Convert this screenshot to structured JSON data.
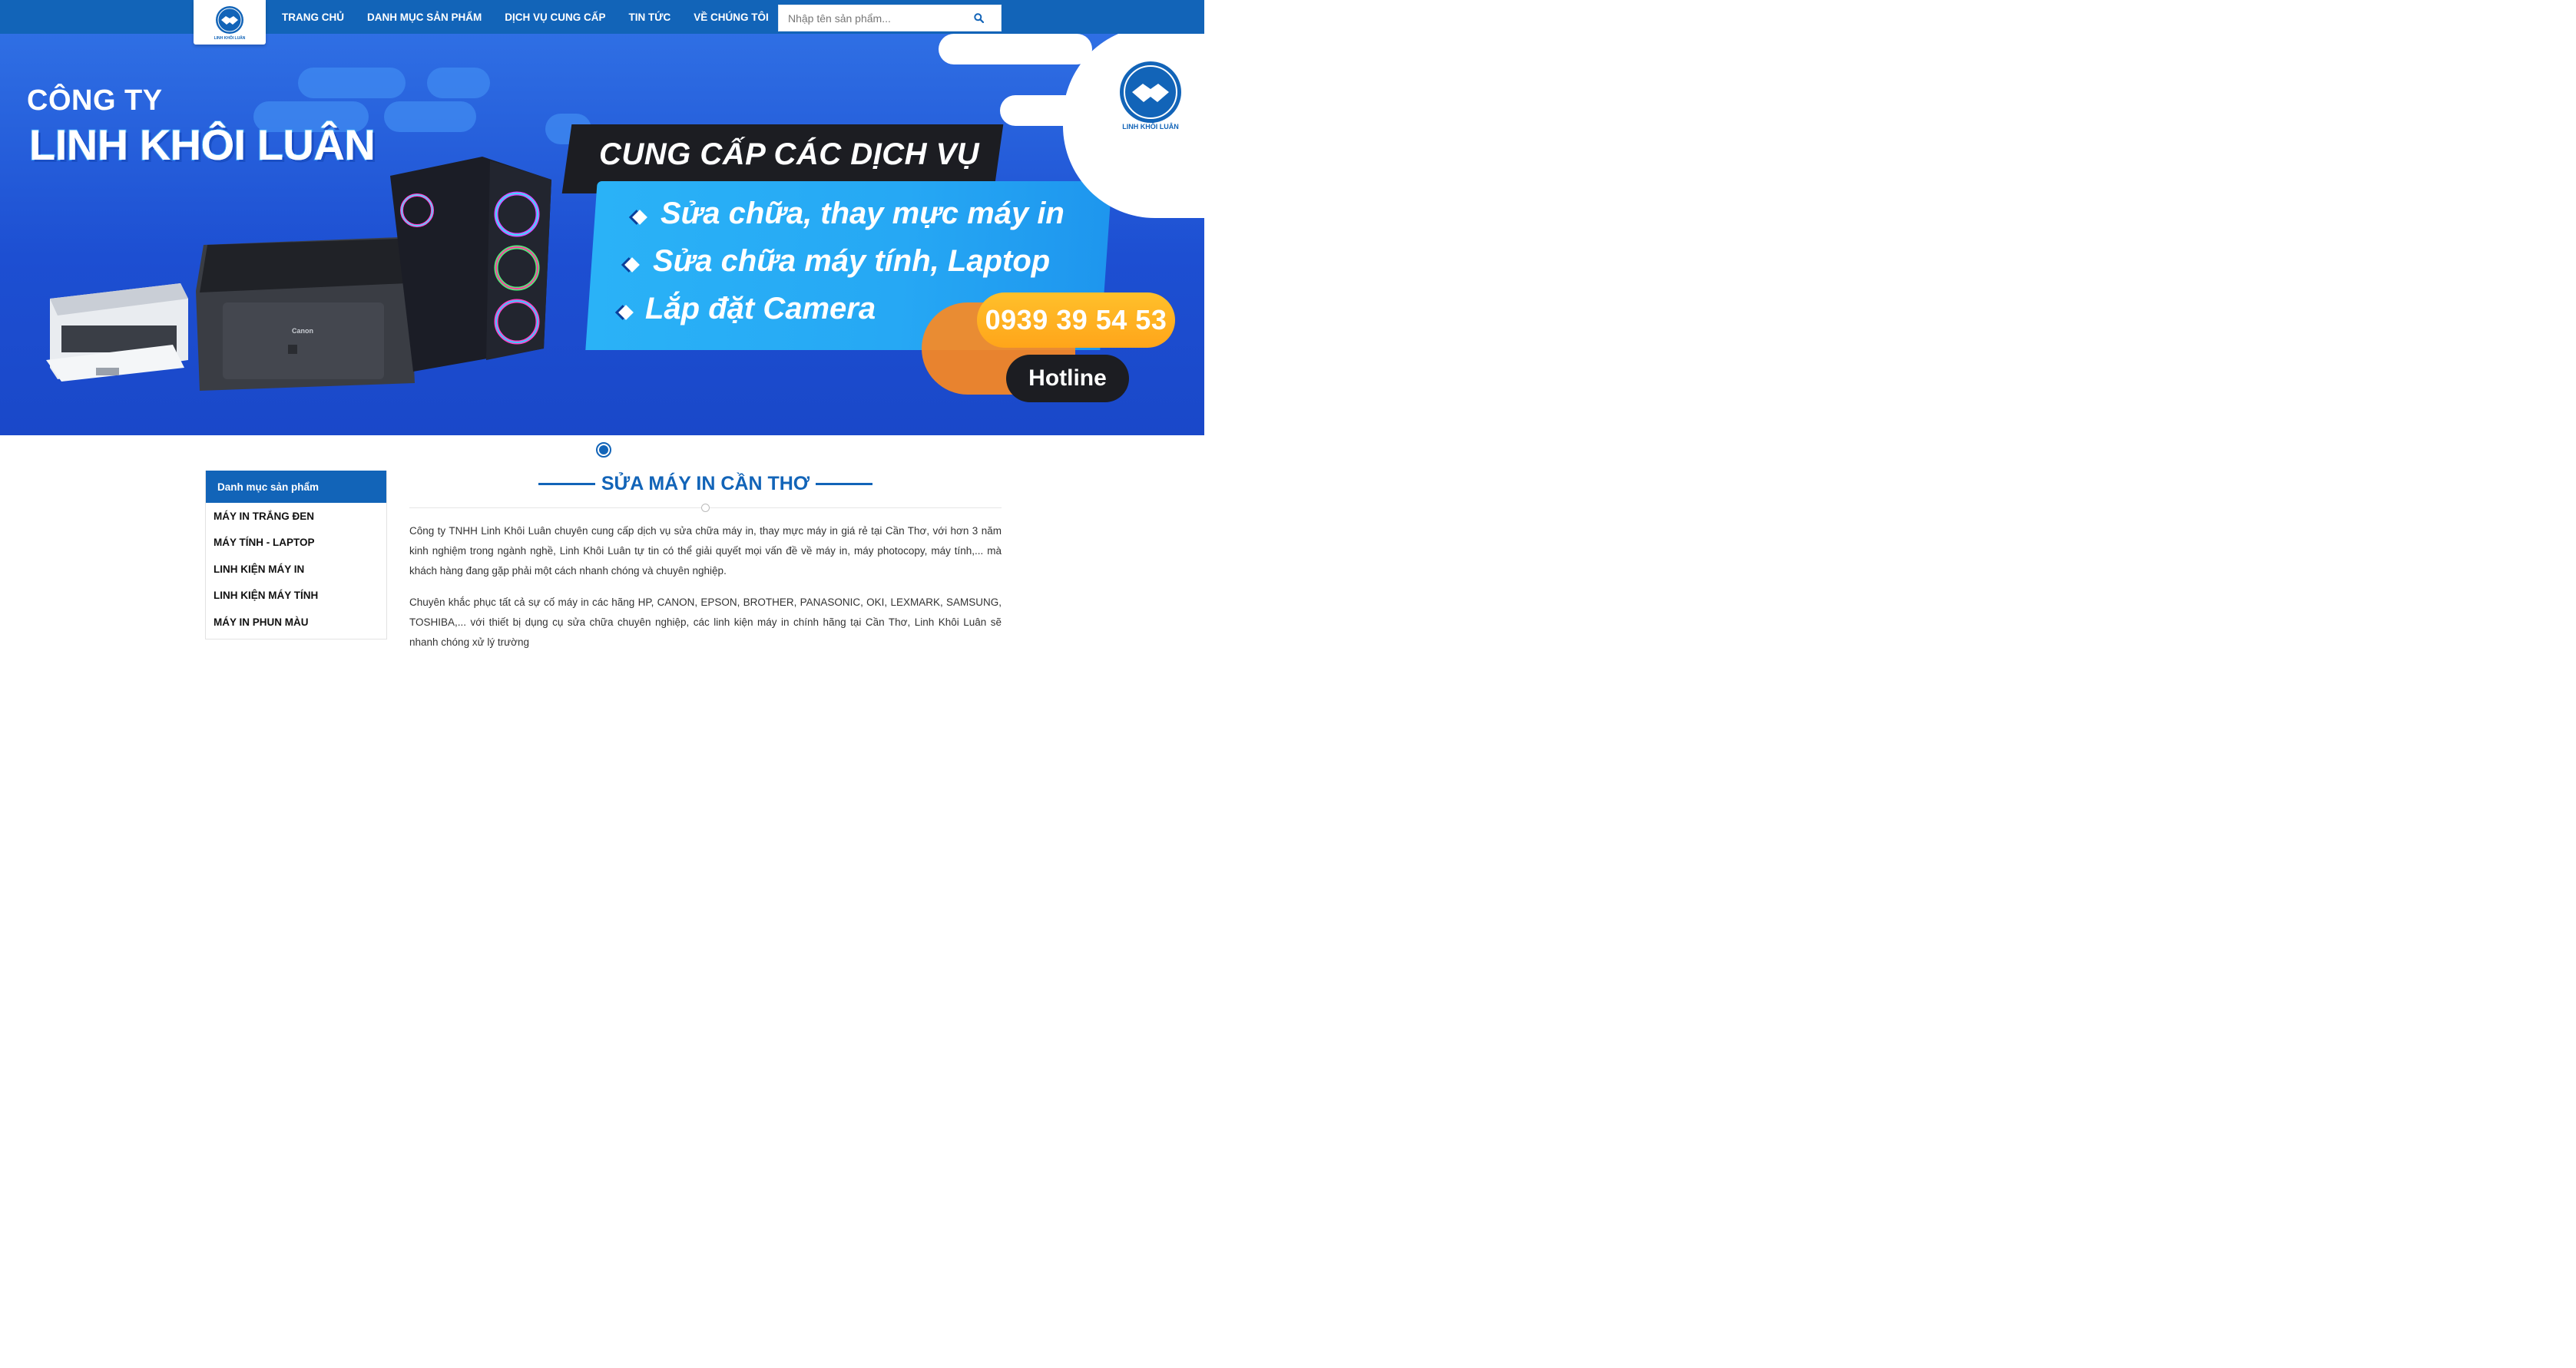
{
  "header": {
    "logo_text": "LINH KHÔI LUÂN",
    "nav": [
      "TRANG CHỦ",
      "DANH MỤC SẢN PHẨM",
      "DỊCH VỤ CUNG CẤP",
      "TIN TỨC",
      "VỀ CHÚNG TÔI"
    ],
    "search_placeholder": "Nhập tên sản phẩm..."
  },
  "banner": {
    "company_prefix": "CÔNG TY",
    "company_name": "LINH KHÔI LUÂN",
    "services_title": "CUNG CẤP CÁC DỊCH VỤ",
    "services": [
      "Sửa chữa, thay mực máy in",
      "Sửa chữa máy tính, Laptop",
      "Lắp đặt Camera"
    ],
    "phone": "0939 39 54 53",
    "hotline_label": "Hotline",
    "logo_text": "LINH KHÔI LUÂN"
  },
  "sidebar": {
    "title": "Danh mục sản phẩm",
    "items": [
      "MÁY IN TRẮNG ĐEN",
      "MÁY TÍNH - LAPTOP",
      "LINH KIỆN MÁY IN",
      "LINH KIỆN MÁY TÍNH",
      "MÁY IN PHUN MÀU"
    ]
  },
  "content": {
    "title": "SỬA MÁY IN CẦN THƠ",
    "paragraph1": "Công ty TNHH Linh Khôi Luân chuyên cung cấp dịch vụ sửa chữa máy in, thay mực máy in giá rẻ tại Cần Thơ, với hơn 3 năm kinh nghiệm trong ngành nghề, Linh Khôi Luân tự tin có thể giải quyết mọi vấn đề về máy in, máy photocopy, máy tính,... mà khách hàng đang gặp phải một cách nhanh chóng và chuyên nghiệp.",
    "paragraph2": "Chuyên khắc phục tất cả sự cố máy in các hãng HP, CANON, EPSON, BROTHER, PANASONIC, OKI, LEXMARK, SAMSUNG, TOSHIBA,... với thiết bị dụng cụ sửa chữa chuyên nghiệp, các linh kiện máy in chính hãng tại Cần Thơ, Linh Khôi Luân sẽ nhanh chóng xử lý trường"
  },
  "colors": {
    "brand_blue": "#1264b8",
    "banner_blue": "#1d4fd2",
    "accent_cyan": "#26a8f4",
    "accent_orange": "#ffa51a"
  }
}
